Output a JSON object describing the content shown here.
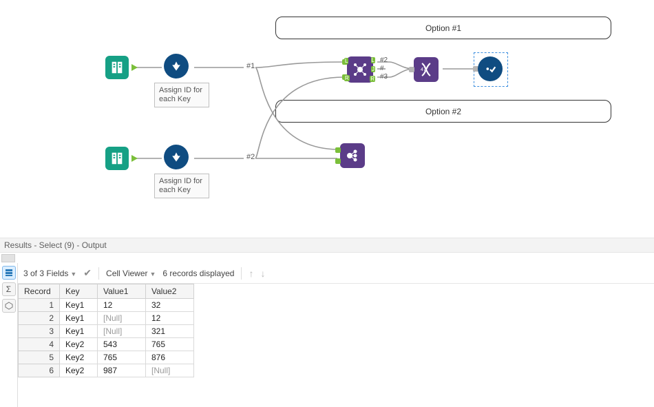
{
  "canvas": {
    "option1_label": "Option #1",
    "option2_label": "Option #2",
    "assign_id_label": "Assign ID for each Key",
    "flow1_label": "#1",
    "flow2_label": "#2",
    "join_out_j": "#",
    "join_out_l": "#2",
    "join_out_r": "#3",
    "join_in_l": "L",
    "join_in_r": "R",
    "join_mid": "J"
  },
  "panel": {
    "title": "Results - Select (9) - Output",
    "fields_summary": "3 of 3 Fields",
    "cell_viewer": "Cell Viewer",
    "records_text": "6 records displayed"
  },
  "table": {
    "columns": [
      "Record",
      "Key",
      "Value1",
      "Value2"
    ],
    "rows": [
      {
        "rec": "1",
        "key": "Key1",
        "v1": "12",
        "v2": "32"
      },
      {
        "rec": "2",
        "key": "Key1",
        "v1": "[Null]",
        "v2": "12"
      },
      {
        "rec": "3",
        "key": "Key1",
        "v1": "[Null]",
        "v2": "321"
      },
      {
        "rec": "4",
        "key": "Key2",
        "v1": "543",
        "v2": "765"
      },
      {
        "rec": "5",
        "key": "Key2",
        "v1": "765",
        "v2": "876"
      },
      {
        "rec": "6",
        "key": "Key2",
        "v1": "987",
        "v2": "[Null]"
      }
    ]
  }
}
